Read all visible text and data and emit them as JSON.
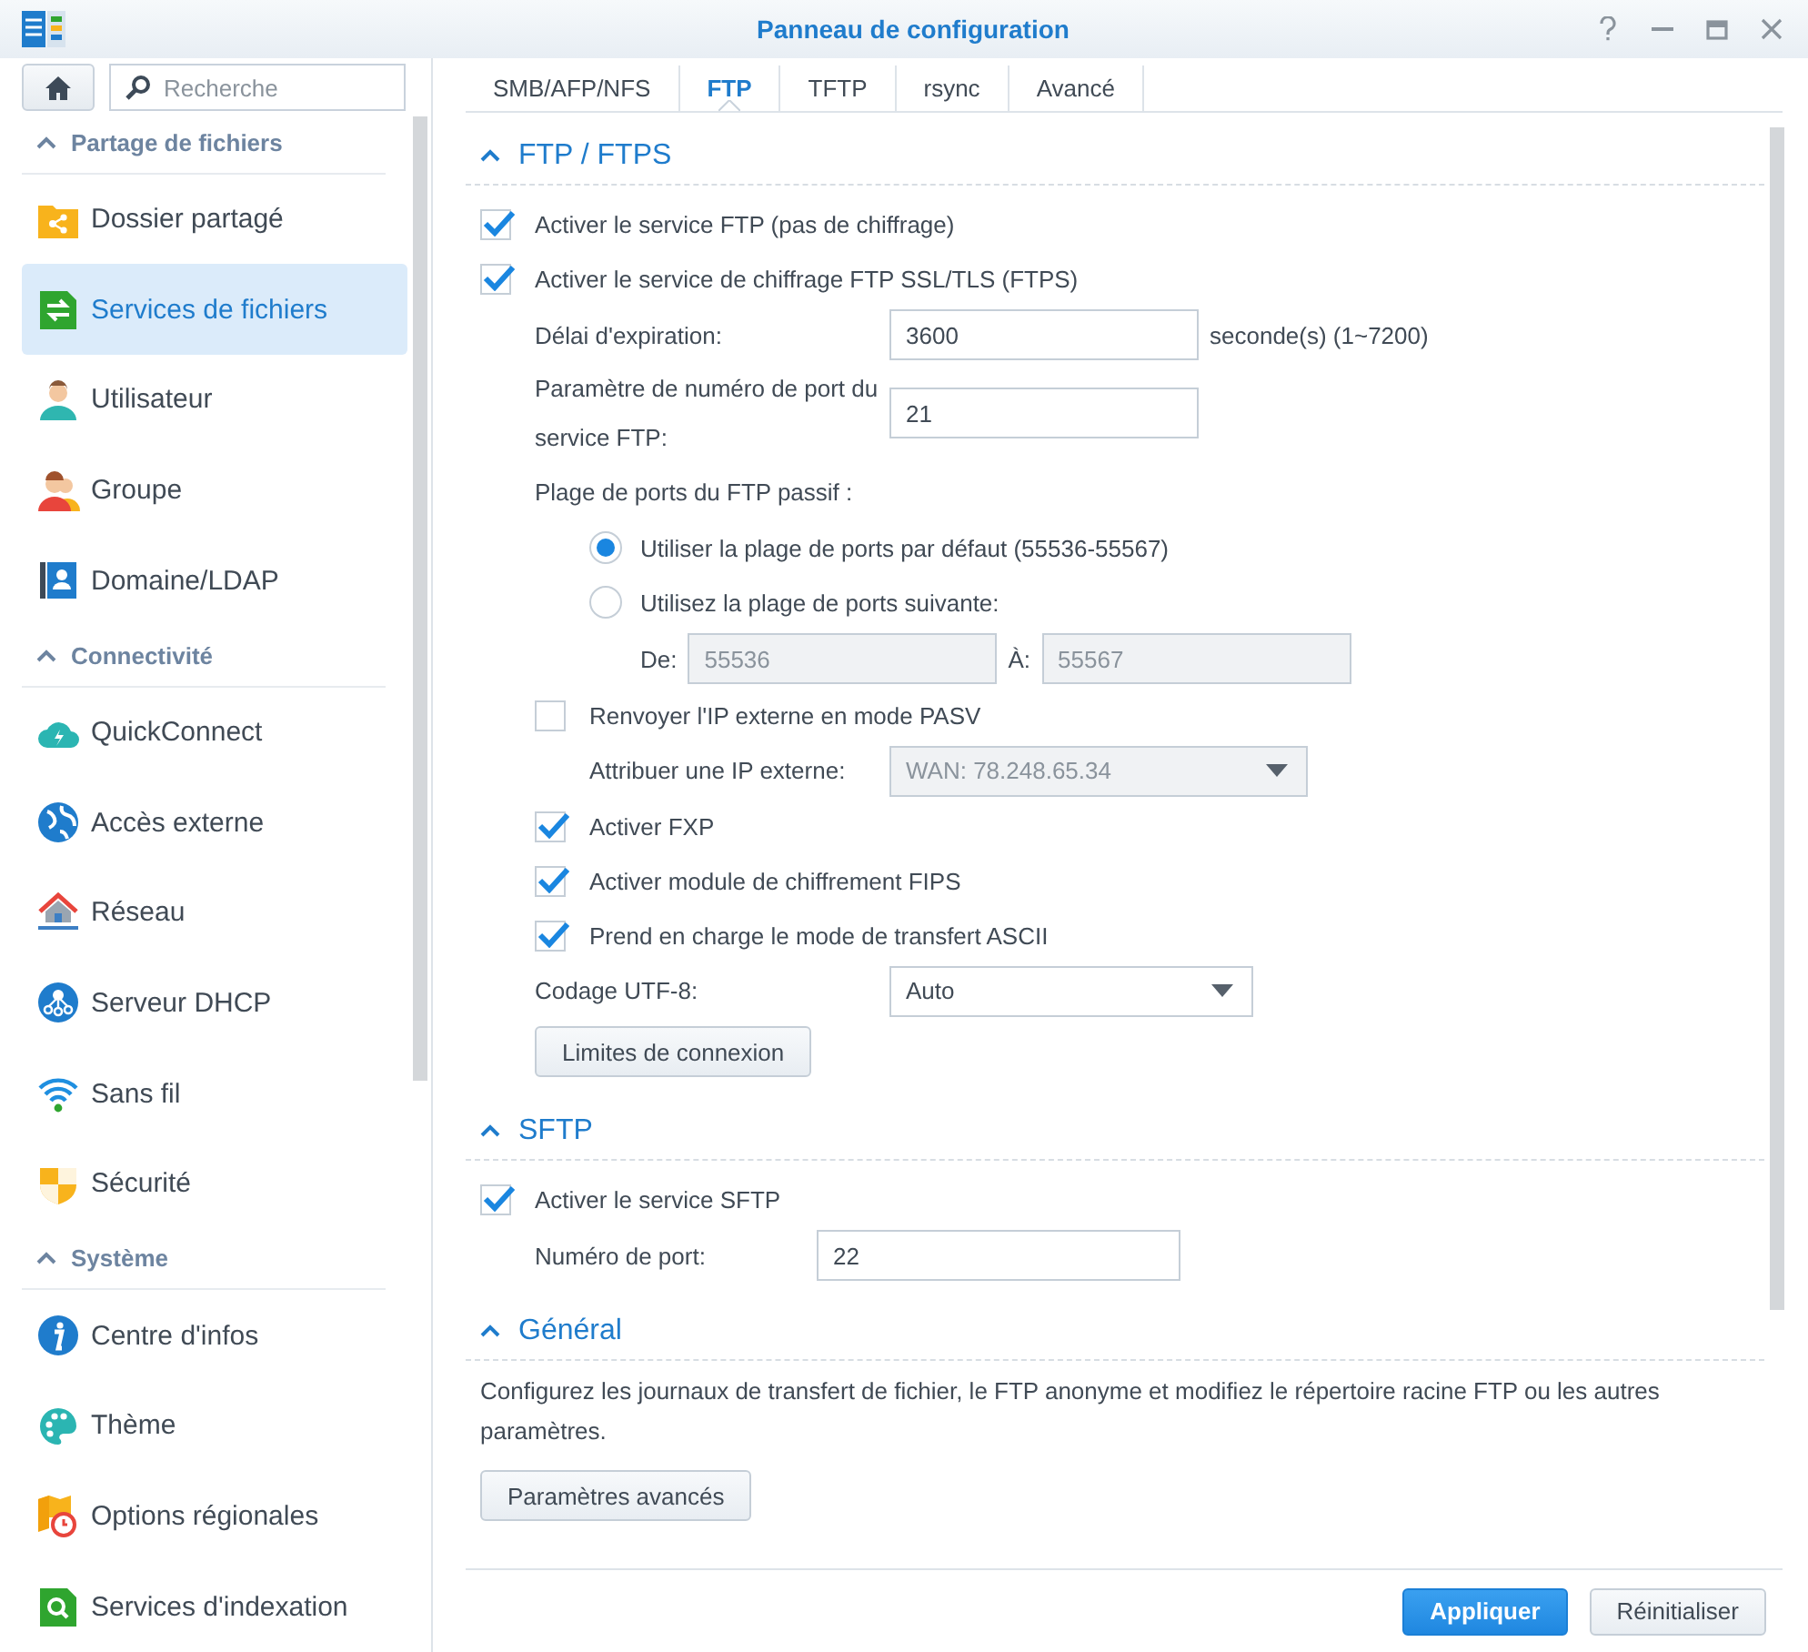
{
  "window": {
    "title": "Panneau de configuration"
  },
  "sidebar": {
    "search": {
      "placeholder": "Recherche"
    },
    "sections": [
      {
        "title": "Partage de fichiers",
        "expanded": true,
        "items": [
          {
            "label": "Dossier partagé",
            "selected": false
          },
          {
            "label": "Services de fichiers",
            "selected": true
          },
          {
            "label": "Utilisateur",
            "selected": false
          },
          {
            "label": "Groupe",
            "selected": false
          },
          {
            "label": "Domaine/LDAP",
            "selected": false
          }
        ]
      },
      {
        "title": "Connectivité",
        "expanded": true,
        "items": [
          {
            "label": "QuickConnect",
            "selected": false
          },
          {
            "label": "Accès externe",
            "selected": false
          },
          {
            "label": "Réseau",
            "selected": false
          },
          {
            "label": "Serveur DHCP",
            "selected": false
          },
          {
            "label": "Sans fil",
            "selected": false
          },
          {
            "label": "Sécurité",
            "selected": false
          }
        ]
      },
      {
        "title": "Système",
        "expanded": true,
        "items": [
          {
            "label": "Centre d'infos",
            "selected": false
          },
          {
            "label": "Thème",
            "selected": false
          },
          {
            "label": "Options régionales",
            "selected": false
          },
          {
            "label": "Services d'indexation",
            "selected": false
          }
        ]
      }
    ]
  },
  "tabs": [
    {
      "label": "SMB/AFP/NFS",
      "selected": false
    },
    {
      "label": "FTP",
      "selected": true
    },
    {
      "label": "TFTP",
      "selected": false
    },
    {
      "label": "rsync",
      "selected": false
    },
    {
      "label": "Avancé",
      "selected": false
    }
  ],
  "sections": [
    {
      "title": "FTP / FTPS",
      "expanded": true,
      "rows": [
        {
          "kind": "checkbox",
          "label": "Activer le service FTP (pas de chiffrage)",
          "checked": true
        },
        {
          "kind": "checkbox",
          "label": "Activer le service de chiffrage FTP SSL/TLS (FTPS)",
          "checked": true,
          "children": [
            {
              "kind": "field",
              "label": "Délai d'expiration:",
              "value": "3600",
              "suffix": "seconde(s) (1~7200)"
            },
            {
              "kind": "field",
              "label": "Paramètre de numéro de port du service FTP:",
              "value": "21"
            },
            {
              "kind": "label",
              "label": "Plage de ports du FTP passif :",
              "children": [
                {
                  "kind": "radio",
                  "label": "Utiliser la plage de ports par défaut (55536-55567)",
                  "selected": true
                },
                {
                  "kind": "radio",
                  "label": "Utilisez la plage de ports suivante:",
                  "selected": false,
                  "children": [
                    {
                      "kind": "range",
                      "from_label": "De:",
                      "from_value": "55536",
                      "to_label": "À:",
                      "to_value": "55567",
                      "disabled": true
                    }
                  ]
                }
              ]
            },
            {
              "kind": "checkbox",
              "label": "Renvoyer l'IP externe en mode PASV",
              "checked": false,
              "children": [
                {
                  "kind": "select",
                  "label": "Attribuer une IP externe:",
                  "value": "WAN: 78.248.65.34",
                  "disabled": true
                }
              ]
            },
            {
              "kind": "checkbox",
              "label": "Activer FXP",
              "checked": true
            },
            {
              "kind": "checkbox",
              "label": "Activer module de chiffrement FIPS",
              "checked": true
            },
            {
              "kind": "checkbox",
              "label": "Prend en charge le mode de transfert ASCII",
              "checked": true
            },
            {
              "kind": "select",
              "label": "Codage UTF-8:",
              "value": "Auto",
              "disabled": false
            },
            {
              "kind": "button",
              "label": "Limites de connexion"
            }
          ]
        }
      ]
    },
    {
      "title": "SFTP",
      "expanded": true,
      "rows": [
        {
          "kind": "checkbox",
          "label": "Activer le service SFTP",
          "checked": true,
          "children": [
            {
              "kind": "field",
              "label": "Numéro de port:",
              "value": "22"
            }
          ]
        }
      ]
    },
    {
      "title": "Général",
      "expanded": true,
      "rows": [
        {
          "kind": "text",
          "label": "Configurez les journaux de transfert de fichier, le FTP anonyme et modifiez le répertoire racine FTP ou les autres paramètres."
        },
        {
          "kind": "button",
          "label": "Paramètres avancés"
        }
      ]
    }
  ],
  "footer": {
    "buttons": [
      {
        "label": "Appliquer",
        "kind": "primary"
      },
      {
        "label": "Réinitialiser",
        "kind": "secondary"
      }
    ]
  }
}
